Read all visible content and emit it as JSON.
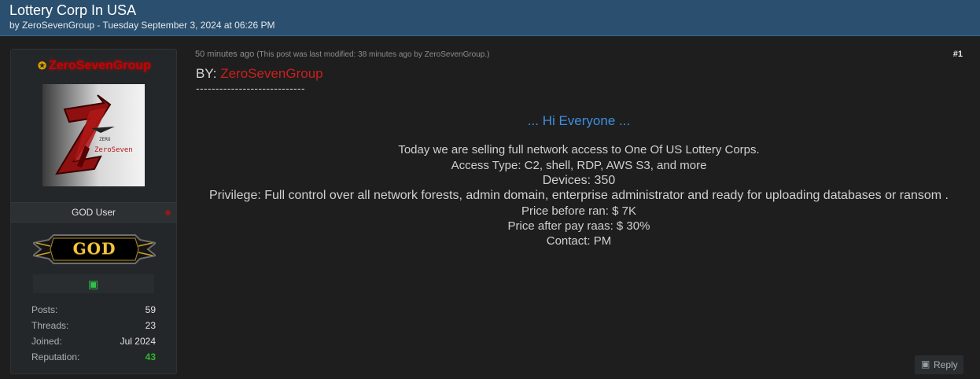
{
  "thread": {
    "title": "Lottery Corp In USA",
    "meta": "by ZeroSevenGroup - Tuesday September 3, 2024 at 06:26 PM"
  },
  "author": {
    "username": "ZeroSevenGroup",
    "usergroup": "GOD User",
    "rank_badge": "GOD",
    "avatar_label": "ZeroSeven",
    "stats": [
      {
        "label": "Posts:",
        "value": "59"
      },
      {
        "label": "Threads:",
        "value": "23"
      },
      {
        "label": "Joined:",
        "value": "Jul 2024"
      },
      {
        "label": "Reputation:",
        "value": "43"
      }
    ]
  },
  "post": {
    "time": "50 minutes ago",
    "modified": "(This post was last modified: 38 minutes ago by ZeroSevenGroup.)",
    "number": "#1",
    "by_prefix": "BY:",
    "by_name": "ZeroSevenGroup",
    "separator": "----------------------------",
    "greeting": "... Hi Everyone ...",
    "lines": [
      "Today we are selling full network access to One Of US Lottery Corps.",
      "Access Type: C2, shell, RDP, AWS S3, and more",
      "Devices: 350",
      "Privilege: Full control over all network forests, admin domain, enterprise administrator and ready for uploading databases or ransom .",
      "Price before ran: $ 7K",
      "Price after pay raas: $ 30%",
      "Contact: PM"
    ]
  },
  "actions": {
    "reply": "Reply"
  },
  "colors": {
    "header_bg": "#2b4f6e",
    "username_red": "#cc0000",
    "greeting_blue": "#3d8fe0",
    "reputation_green": "#2eb82e",
    "rank_gold": "#f3c53b"
  },
  "icons": {
    "star": "star-icon",
    "award": "award-icon",
    "reply": "reply-icon"
  }
}
